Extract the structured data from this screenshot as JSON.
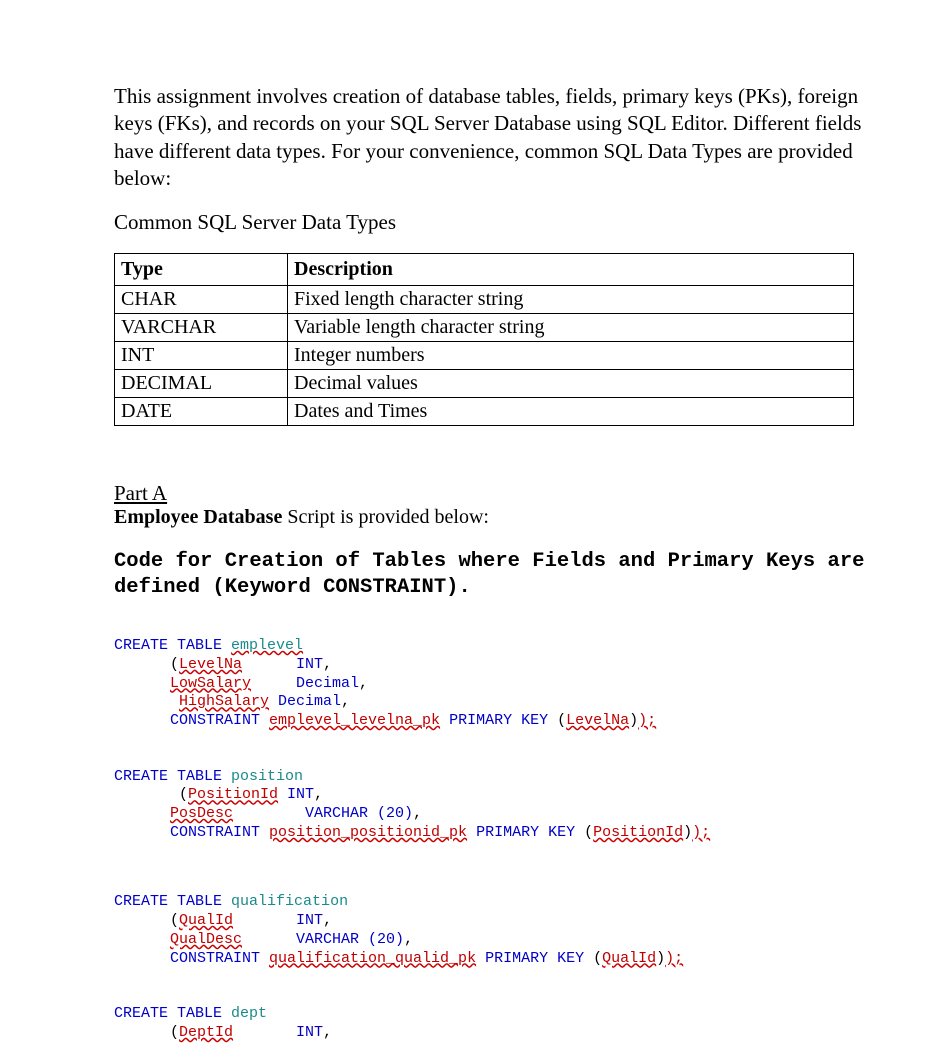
{
  "intro": "This assignment involves creation of database tables, fields, primary keys (PKs), foreign keys (FKs), and records on your SQL Server Database using SQL Editor. Different fields have different data types. For your convenience, common SQL Data Types are provided below:",
  "subhead": "Common SQL Server Data Types",
  "table": {
    "headers": {
      "type": "Type",
      "description": "Description"
    },
    "rows": [
      {
        "type": "CHAR",
        "description": "Fixed length character string"
      },
      {
        "type": "VARCHAR",
        "description": "Variable length character string"
      },
      {
        "type": "INT",
        "description": "Integer numbers"
      },
      {
        "type": "DECIMAL",
        "description": "Decimal values"
      },
      {
        "type": "DATE",
        "description": "Dates and Times"
      }
    ]
  },
  "partA": {
    "title": "Part A",
    "emp_bold": "Employee Database",
    "emp_rest": " Script is provided below:",
    "codehead": "Code for Creation of Tables where Fields and Primary Keys are defined (Keyword CONSTRAINT)."
  },
  "kw": {
    "create_table": "CREATE TABLE",
    "constraint": "CONSTRAINT",
    "pk": "PRIMARY KEY",
    "int": "INT",
    "decimal": "Decimal",
    "varchar20": "VARCHAR (20)"
  },
  "code": {
    "emplevel": {
      "name": "emplevel",
      "f1": "LevelNa",
      "f2": "LowSalary",
      "f3": "HighSalary",
      "cons": "emplevel_levelna_pk",
      "pkcol": "LevelNa",
      "end": ");"
    },
    "position": {
      "name": "position",
      "f1": "PositionId",
      "f2": "PosDesc",
      "cons": "position_positionid_pk",
      "pkcol": "PositionId",
      "end": ");"
    },
    "qualification": {
      "name": "qualification",
      "f1": "QualId",
      "f2": "QualDesc",
      "cons": "qualification_qualid_pk",
      "pkcol": "QualId",
      "end": ");"
    },
    "dept": {
      "name": "dept",
      "f1": "DeptId"
    }
  }
}
